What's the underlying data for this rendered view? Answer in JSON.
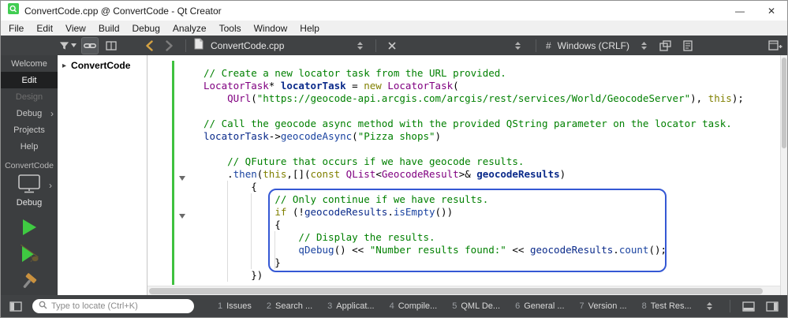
{
  "colors": {
    "toolbar-bg": "#404244",
    "sidebar-bg": "#3c3e40",
    "selected-mode-bg": "#1f2021",
    "statusbar-bg": "#404244",
    "comment": "#008000",
    "string": "#008000",
    "keyword": "#808000",
    "type": "#800080",
    "variable": "#0a2a8a",
    "function": "#1a43a0",
    "annotation-blue": "#3558d4",
    "run-green": "#3fca42",
    "back-arrow-gold": "#d6a343",
    "vcs-green": "#3fc13f"
  },
  "window": {
    "title": "ConvertCode.cpp @ ConvertCode - Qt Creator",
    "minimize_glyph": "—",
    "close_glyph": "✕"
  },
  "menubar": {
    "items": [
      "File",
      "Edit",
      "View",
      "Build",
      "Debug",
      "Analyze",
      "Tools",
      "Window",
      "Help"
    ]
  },
  "toolbar": {
    "open_document_label": "ConvertCode.cpp",
    "hash_symbol": "#",
    "line_ending_label": "Windows (CRLF)"
  },
  "mode_sidebar": {
    "arrow_glyph": "›",
    "modes": [
      {
        "label": "Welcome",
        "state": "normal"
      },
      {
        "label": "Edit",
        "state": "selected"
      },
      {
        "label": "Design",
        "state": "disabled"
      },
      {
        "label": "Debug",
        "state": "normal",
        "arrow": true
      },
      {
        "label": "Projects",
        "state": "normal"
      },
      {
        "label": "Help",
        "state": "normal"
      }
    ],
    "project_label": "ConvertCode",
    "build_config_label": "Debug"
  },
  "project_tree": {
    "expand_glyph": "▸",
    "root_label": "ConvertCode"
  },
  "editor": {
    "lines": [
      {
        "tokens": [
          {
            "t": "// Create a new locator task from the URL provided.",
            "c": "comment"
          }
        ]
      },
      {
        "tokens": [
          {
            "t": "LocatorTask",
            "c": "type"
          },
          {
            "t": "* ",
            "c": "plain"
          },
          {
            "t": "locatorTask",
            "c": "vardecl"
          },
          {
            "t": " = ",
            "c": "plain"
          },
          {
            "t": "new",
            "c": "keyword"
          },
          {
            "t": " ",
            "c": "plain"
          },
          {
            "t": "LocatorTask",
            "c": "type"
          },
          {
            "t": "(",
            "c": "plain"
          }
        ]
      },
      {
        "tokens": [
          {
            "t": "    ",
            "c": "plain"
          },
          {
            "t": "QUrl",
            "c": "type"
          },
          {
            "t": "(",
            "c": "plain"
          },
          {
            "t": "\"https://geocode-api.arcgis.com/arcgis/rest/services/World/GeocodeServer\"",
            "c": "string"
          },
          {
            "t": "), ",
            "c": "plain"
          },
          {
            "t": "this",
            "c": "keyword"
          },
          {
            "t": ");",
            "c": "plain"
          }
        ]
      },
      {
        "tokens": []
      },
      {
        "tokens": [
          {
            "t": "// Call the geocode async method with the provided QString parameter on the locator task.",
            "c": "comment"
          }
        ]
      },
      {
        "tokens": [
          {
            "t": "locatorTask",
            "c": "var"
          },
          {
            "t": "->",
            "c": "plain"
          },
          {
            "t": "geocodeAsync",
            "c": "func"
          },
          {
            "t": "(",
            "c": "plain"
          },
          {
            "t": "\"Pizza shops\"",
            "c": "string"
          },
          {
            "t": ")",
            "c": "plain"
          }
        ]
      },
      {
        "tokens": []
      },
      {
        "tokens": [
          {
            "t": "    ",
            "c": "plain"
          },
          {
            "t": "// QFuture that occurs if we have geocode results.",
            "c": "comment"
          }
        ]
      },
      {
        "tokens": [
          {
            "t": "    .",
            "c": "plain"
          },
          {
            "t": "then",
            "c": "func"
          },
          {
            "t": "(",
            "c": "plain"
          },
          {
            "t": "this",
            "c": "keyword"
          },
          {
            "t": ",[](",
            "c": "plain"
          },
          {
            "t": "const",
            "c": "keyword"
          },
          {
            "t": " ",
            "c": "plain"
          },
          {
            "t": "QList",
            "c": "type"
          },
          {
            "t": "<",
            "c": "plain"
          },
          {
            "t": "GeocodeResult",
            "c": "type"
          },
          {
            "t": ">& ",
            "c": "plain"
          },
          {
            "t": "geocodeResults",
            "c": "vardecl"
          },
          {
            "t": ")",
            "c": "plain"
          }
        ]
      },
      {
        "tokens": [
          {
            "t": "        {",
            "c": "plain"
          }
        ]
      },
      {
        "tokens": [
          {
            "t": "            ",
            "c": "plain"
          },
          {
            "t": "// Only continue if we have results.",
            "c": "comment"
          }
        ]
      },
      {
        "tokens": [
          {
            "t": "            ",
            "c": "plain"
          },
          {
            "t": "if",
            "c": "keyword"
          },
          {
            "t": " (!",
            "c": "plain"
          },
          {
            "t": "geocodeResults",
            "c": "var"
          },
          {
            "t": ".",
            "c": "plain"
          },
          {
            "t": "isEmpty",
            "c": "func"
          },
          {
            "t": "())",
            "c": "plain"
          }
        ]
      },
      {
        "tokens": [
          {
            "t": "            {",
            "c": "plain"
          }
        ]
      },
      {
        "tokens": [
          {
            "t": "                ",
            "c": "plain"
          },
          {
            "t": "// Display the results.",
            "c": "comment"
          }
        ]
      },
      {
        "tokens": [
          {
            "t": "                ",
            "c": "plain"
          },
          {
            "t": "qDebug",
            "c": "func"
          },
          {
            "t": "() << ",
            "c": "plain"
          },
          {
            "t": "\"Number results found:\"",
            "c": "string"
          },
          {
            "t": " << ",
            "c": "plain"
          },
          {
            "t": "geocodeResults",
            "c": "var"
          },
          {
            "t": ".",
            "c": "plain"
          },
          {
            "t": "count",
            "c": "func"
          },
          {
            "t": "();",
            "c": "plain"
          }
        ]
      },
      {
        "tokens": [
          {
            "t": "            }",
            "c": "plain"
          }
        ]
      },
      {
        "tokens": [
          {
            "t": "        })",
            "c": "plain"
          }
        ]
      }
    ]
  },
  "statusbar": {
    "locator_placeholder": "Type to locate (Ctrl+K)",
    "output_panes": [
      {
        "key": "1",
        "label": "Issues"
      },
      {
        "key": "2",
        "label": "Search ..."
      },
      {
        "key": "3",
        "label": "Applicat..."
      },
      {
        "key": "4",
        "label": "Compile..."
      },
      {
        "key": "5",
        "label": "QML De..."
      },
      {
        "key": "6",
        "label": "General ..."
      },
      {
        "key": "7",
        "label": "Version ..."
      },
      {
        "key": "8",
        "label": "Test Res..."
      }
    ]
  }
}
